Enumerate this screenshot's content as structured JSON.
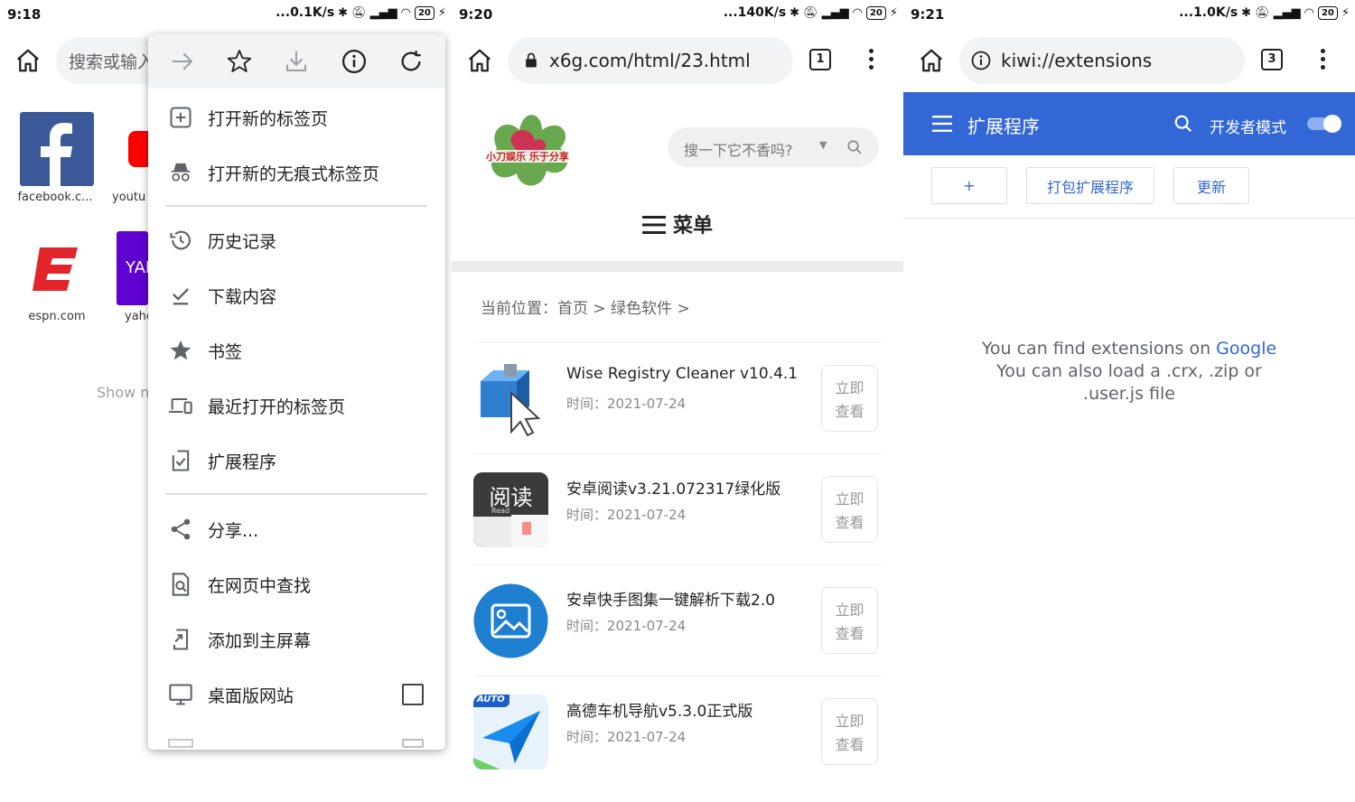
{
  "panel1": {
    "status": {
      "time": "9:18",
      "speed": "...0.1K/s",
      "battery": "20"
    },
    "omnibox_placeholder": "搜索或输入",
    "tiles": [
      {
        "label": "facebook.c...",
        "icon": "facebook-logo"
      },
      {
        "label": "youtu",
        "icon": "youtube-logo"
      },
      {
        "label": "espn.com",
        "icon": "espn-logo"
      },
      {
        "label": "yaho",
        "icon": "yahoo-logo"
      }
    ],
    "show_more": "Show n",
    "menu": {
      "top_icons": [
        "forward-icon",
        "star-icon",
        "download-icon",
        "info-icon",
        "refresh-icon"
      ],
      "items": [
        {
          "label": "打开新的标签页",
          "icon": "new-tab-icon"
        },
        {
          "label": "打开新的无痕式标签页",
          "icon": "incognito-icon"
        },
        {
          "label": "历史记录",
          "icon": "history-icon"
        },
        {
          "label": "下载内容",
          "icon": "downloads-icon"
        },
        {
          "label": "书签",
          "icon": "bookmark-star-icon"
        },
        {
          "label": "最近打开的标签页",
          "icon": "devices-icon"
        },
        {
          "label": "扩展程序",
          "icon": "extensions-icon"
        },
        {
          "label": "分享...",
          "icon": "share-icon"
        },
        {
          "label": "在网页中查找",
          "icon": "find-in-page-icon"
        },
        {
          "label": "添加到主屏幕",
          "icon": "add-to-home-icon"
        },
        {
          "label": "桌面版网站",
          "icon": "desktop-icon"
        }
      ]
    }
  },
  "panel2": {
    "status": {
      "time": "9:20",
      "speed": "...140K/s",
      "battery": "20"
    },
    "url": "x6g.com/html/23.html",
    "tab_count": "1",
    "site_search_placeholder": "搜一下它不香吗?",
    "menu_label": "菜单",
    "breadcrumb": "当前位置：首页 > 绿色软件 >",
    "items": [
      {
        "title": "Wise Registry Cleaner v10.4.1",
        "date": "时间：2021-07-24",
        "view": "立即查看",
        "thumb_color": "#2f7fd1"
      },
      {
        "title": "安卓阅读v3.21.072317绿化版",
        "date": "时间：2021-07-24",
        "view": "立即查看",
        "thumb_color": "#3a3a3a"
      },
      {
        "title": "安卓快手图集一键解析下载2.0",
        "date": "时间：2021-07-24",
        "view": "立即查看",
        "thumb_color": "#1e7fd0"
      },
      {
        "title": "高德车机导航v5.3.0正式版",
        "date": "时间：2021-07-24",
        "view": "立即查看",
        "thumb_color": "#1a8cf0"
      }
    ],
    "thumb_text": {
      "read": "阅读",
      "read_sub": "Read",
      "auto": "AUTO"
    },
    "logo_text": "小刀娱乐 乐于分享"
  },
  "panel3": {
    "status": {
      "time": "9:21",
      "speed": "...1.0K/s",
      "battery": "20"
    },
    "url": "kiwi://extensions",
    "tab_count": "3",
    "header_title": "扩展程序",
    "dev_mode_label": "开发者模式",
    "dev_mode_on": true,
    "buttons": {
      "add": "+",
      "pack": "打包扩展程序",
      "update": "更新"
    },
    "message": {
      "line1_prefix": "You can find extensions on ",
      "line1_link": "Google",
      "line2": "You can also load a .crx, .zip or",
      "line3": ".user.js file"
    },
    "accent": "#3367d6"
  }
}
